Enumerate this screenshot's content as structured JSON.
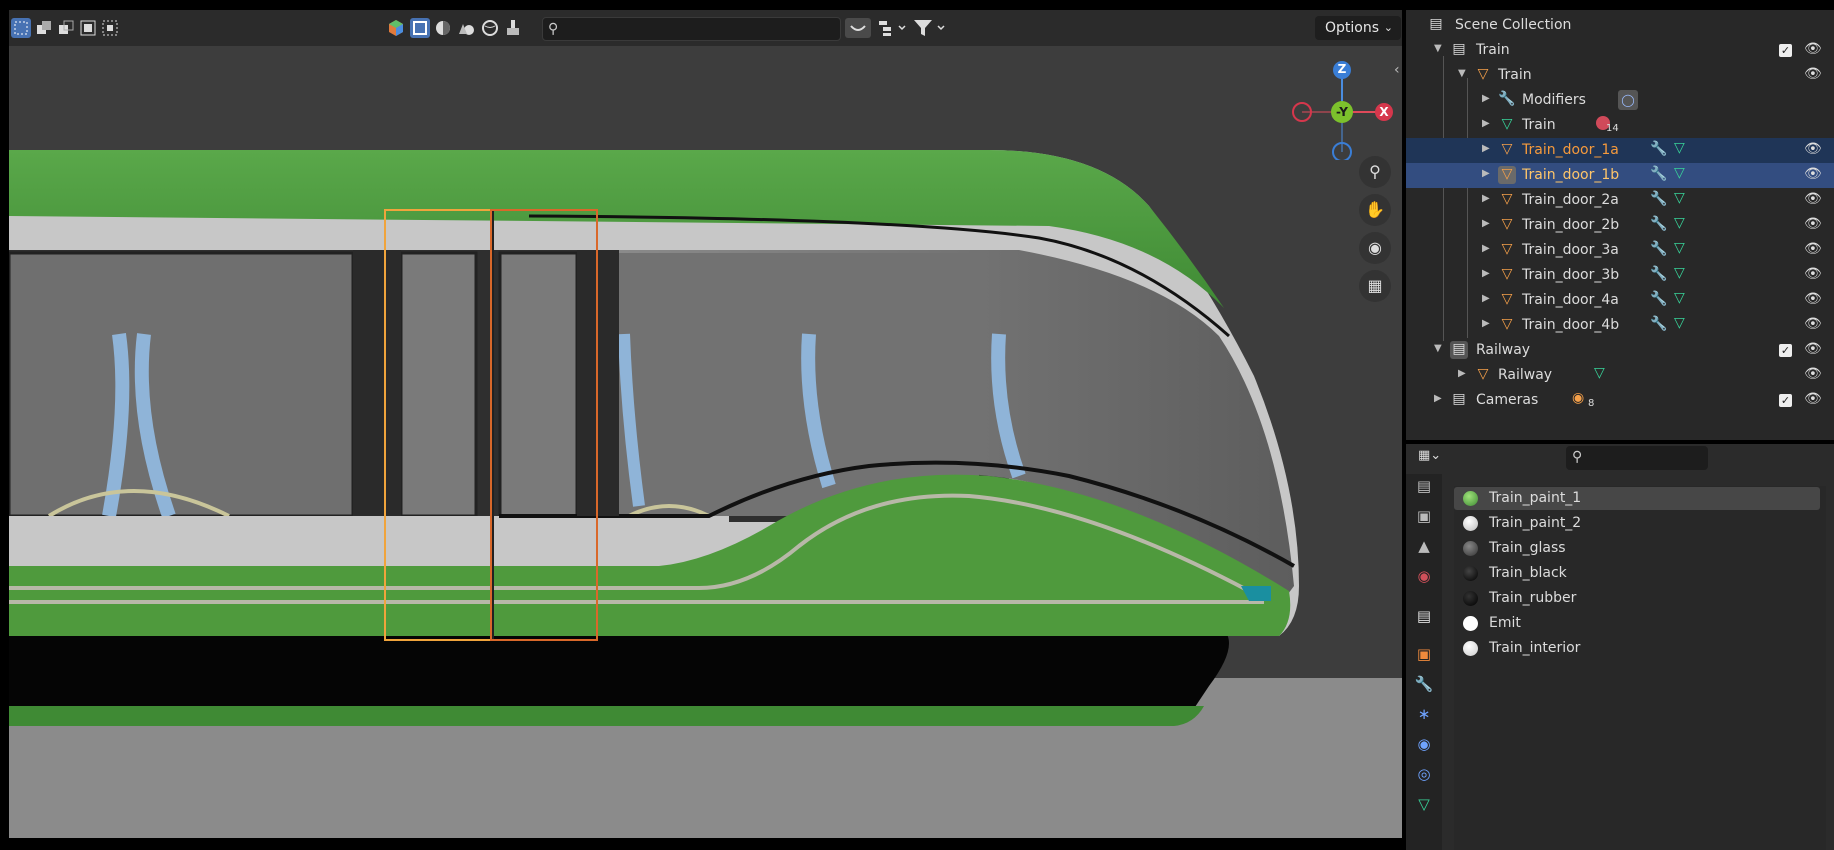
{
  "viewport": {
    "header": {
      "search_placeholder": "",
      "options_label": "Options",
      "icons": [
        "select-box-icon",
        "extend-selection-icon",
        "subtract-selection-icon",
        "invert-selection-icon",
        "intersect-selection-icon",
        "display-mode-icon",
        "hierarchy-icon",
        "filter-icon"
      ]
    },
    "gizmo": {
      "z_label": "Z",
      "y_label": "-Y",
      "x_label": "X"
    },
    "nav_icons": [
      "zoom-icon",
      "pan-hand-icon",
      "camera-view-icon",
      "ortho-grid-icon"
    ]
  },
  "outliner": {
    "rows": [
      {
        "label": "Scene Collection",
        "type": "scene"
      },
      {
        "label": "Train",
        "type": "collection",
        "checked": true
      },
      {
        "label": "Train",
        "type": "object"
      },
      {
        "label": "Modifiers",
        "type": "modifiers"
      },
      {
        "label": "Train",
        "type": "mesh",
        "badge": "14"
      },
      {
        "label": "Train_door_1a",
        "type": "object",
        "state": "selected"
      },
      {
        "label": "Train_door_1b",
        "type": "object",
        "state": "active"
      },
      {
        "label": "Train_door_2a",
        "type": "object"
      },
      {
        "label": "Train_door_2b",
        "type": "object"
      },
      {
        "label": "Train_door_3a",
        "type": "object"
      },
      {
        "label": "Train_door_3b",
        "type": "object"
      },
      {
        "label": "Train_door_4a",
        "type": "object"
      },
      {
        "label": "Train_door_4b",
        "type": "object"
      },
      {
        "label": "Railway",
        "type": "collection",
        "checked": true
      },
      {
        "label": "Railway",
        "type": "object"
      },
      {
        "label": "Cameras",
        "type": "collection",
        "checked": true,
        "badge": "8"
      }
    ]
  },
  "properties": {
    "search_placeholder": "",
    "materials": [
      {
        "label": "Train_paint_1",
        "color": "#5fbf3a",
        "active": true
      },
      {
        "label": "Train_paint_2",
        "color": "#f2f2f2"
      },
      {
        "label": "Train_glass",
        "color": "#5a5a5a"
      },
      {
        "label": "Train_black",
        "color": "#0a0a0a"
      },
      {
        "label": "Train_rubber",
        "color": "#111111"
      },
      {
        "label": "Emit",
        "color": "#ffffff"
      },
      {
        "label": "Train_interior",
        "color": "#efefef"
      }
    ],
    "tab_icons": [
      "render-icon",
      "output-icon",
      "view-layer-icon",
      "scene-icon",
      "world-icon",
      "collection-icon",
      "object-icon",
      "modifier-icon",
      "particles-icon",
      "physics-icon",
      "constraints-icon",
      "data-icon"
    ]
  },
  "colors": {
    "selected_text": "#f59a3c",
    "active_row": "#334d80",
    "selected_row": "#1f3557",
    "train_green": "#4f9a3d"
  }
}
